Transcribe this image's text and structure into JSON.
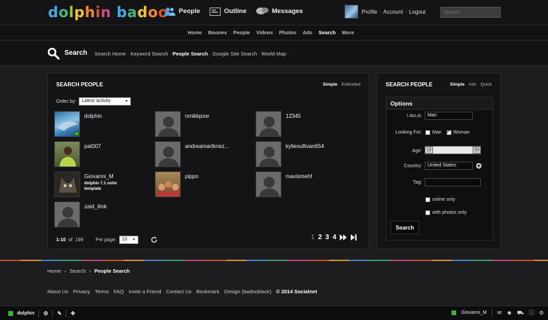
{
  "brand": {
    "logo_text": "dolphin badoo"
  },
  "topnav": {
    "items": [
      {
        "label": "People"
      },
      {
        "label": "Outline"
      },
      {
        "label": "Messages"
      }
    ]
  },
  "usermenu": {
    "profile": "Profile",
    "account": "Account",
    "logout": "Logout",
    "search_placeholder": "Search..."
  },
  "mainmenu": {
    "items": [
      "Home",
      "Boonex",
      "People",
      "Videos",
      "Photos",
      "Ads",
      "Search",
      "More"
    ],
    "active": "Search"
  },
  "subbar": {
    "title": "Search",
    "links": [
      "Search Home",
      "Keyword Search",
      "People Search",
      "Google Site Search",
      "World Map"
    ],
    "active": "People Search"
  },
  "results": {
    "title": "Search People",
    "tabs": [
      "Simple",
      "Extended"
    ],
    "order_by_label": "Order by:",
    "order_by_value": "Latest activity",
    "people": [
      {
        "name": "dolphin",
        "status": ""
      },
      {
        "name": "nmikkpxw",
        "status": ""
      },
      {
        "name": "12345",
        "status": ""
      },
      {
        "name": "pat007",
        "status": ""
      },
      {
        "name": "andreamartknez...",
        "status": ""
      },
      {
        "name": "kyliesullivan654",
        "status": ""
      },
      {
        "name": "Giovanni_M",
        "status": "dolphin 7.1 osho template"
      },
      {
        "name": "pippo",
        "status": ""
      },
      {
        "name": "mavismehf",
        "status": ""
      },
      {
        "name": "zaid_ilink",
        "status": ""
      }
    ],
    "range": "1-10",
    "of_label": "of",
    "total": "199",
    "per_page_label": "Per page:",
    "per_page_value": "10",
    "pages": [
      "1",
      "2",
      "3",
      "4"
    ],
    "current_page": "1"
  },
  "form": {
    "title": "Search People",
    "tabs": [
      "Simple",
      "Adv",
      "Quick"
    ],
    "options_label": "Options",
    "i_am_label": "I Am A:",
    "i_am_value": "Man",
    "looking_for_label": "Looking For:",
    "looking_man": "Man",
    "looking_woman": "Woman",
    "age_label": "Age:",
    "age_min": "18",
    "age_max": "99",
    "country_label": "Country:",
    "country_value": "United States",
    "tag_label": "Tag:",
    "online_only": "online only",
    "with_photos_only": "with photos only",
    "search_button": "Search"
  },
  "footer": {
    "breadcrumb": [
      "Home",
      "Search",
      "People Search"
    ],
    "links": [
      "About Us",
      "Privacy",
      "Terms",
      "FAQ",
      "Invite a Friend",
      "Contact Us",
      "Bookmark",
      "Design (badooblack)"
    ],
    "copyright": "© 2014 Socialnet"
  },
  "dock": {
    "site_label": "dolphin",
    "user_label": "Giovanni_M"
  },
  "colors": {
    "accent_green": "#35b735",
    "panel_bg": "#141416",
    "page_bg": "#1d1d1f"
  }
}
